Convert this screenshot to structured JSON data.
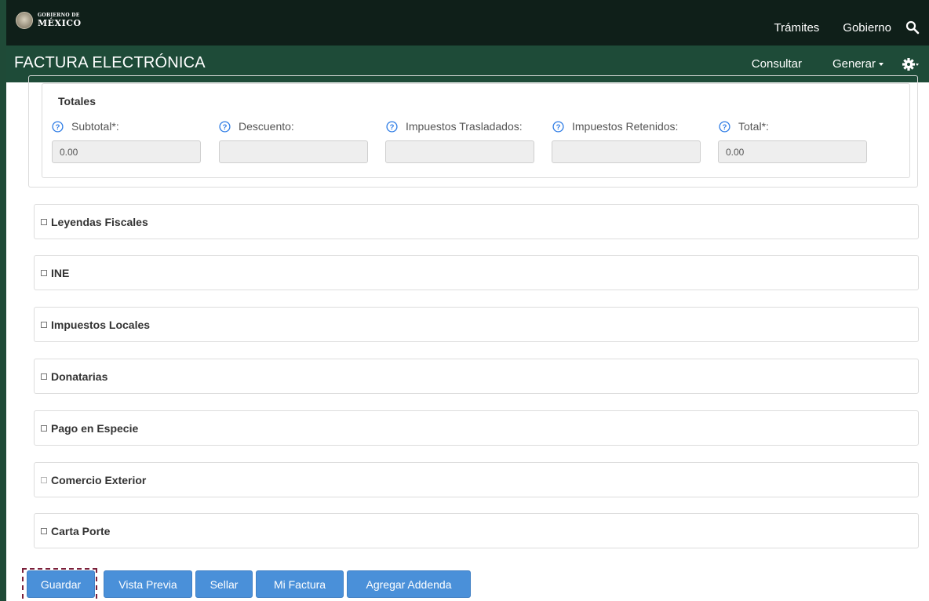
{
  "topbar": {
    "logo_line1": "GOBIERNO DE",
    "logo_line2": "MÉXICO",
    "nav": [
      "Trámites",
      "Gobierno"
    ],
    "search_icon": "search-icon",
    "bg_color": "#0f1f19"
  },
  "subbar": {
    "title": "FACTURA ELECTRÓNICA",
    "consultar": "Consultar",
    "generar": "Generar",
    "settings_icon": "gear-icon",
    "bg_color": "#1e4b38"
  },
  "totales": {
    "title": "Totales",
    "fields": [
      {
        "label": "Subtotal*:",
        "value": "0.00"
      },
      {
        "label": "Descuento:",
        "value": ""
      },
      {
        "label": "Impuestos Trasladados:",
        "value": ""
      },
      {
        "label": "Impuestos Retenidos:",
        "value": ""
      },
      {
        "label": "Total*:",
        "value": "0.00"
      }
    ]
  },
  "sections": [
    {
      "label": "Leyendas Fiscales",
      "disabled": false
    },
    {
      "label": "INE",
      "disabled": false
    },
    {
      "label": "Impuestos Locales",
      "disabled": false
    },
    {
      "label": "Donatarias",
      "disabled": false
    },
    {
      "label": "Pago en Especie",
      "disabled": false
    },
    {
      "label": "Comercio Exterior",
      "disabled": true
    },
    {
      "label": "Carta Porte",
      "disabled": false
    }
  ],
  "buttons": [
    "Guardar",
    "Vista Previa",
    "Sellar",
    "Mi Factura",
    "Agregar Addenda"
  ],
  "accent_color": "#4a90d9",
  "highlight_color": "#7a1f3a"
}
